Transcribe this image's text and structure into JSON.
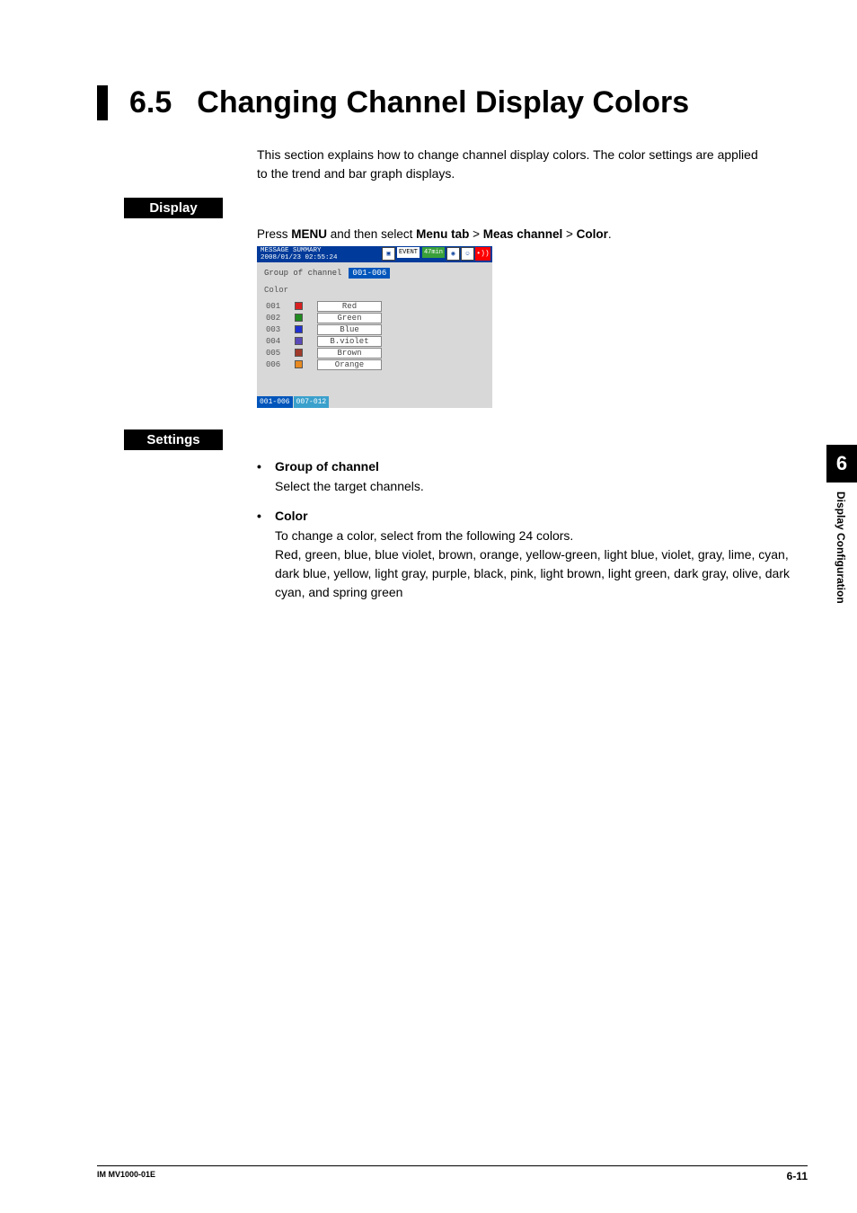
{
  "heading": {
    "num": "6.5",
    "title": "Changing Channel Display Colors"
  },
  "intro": "This section explains how to change channel display colors. The color settings are applied to the trend and bar graph displays.",
  "labels": {
    "display": "Display",
    "settings": "Settings"
  },
  "instruction": {
    "prefix": "Press ",
    "b1": "MENU",
    "mid1": " and then select ",
    "b2": "Menu tab",
    "sep": " > ",
    "b3": "Meas channel",
    "b4": "Color",
    "suffix": "."
  },
  "screenshot": {
    "header_line1": "MESSAGE SUMMARY",
    "header_line2": "2008/01/23 02:55:24",
    "pill_event": "EVENT",
    "pill_time": "47min",
    "group_label": "Group of channel",
    "group_value": "001-006",
    "color_label": "Color",
    "rows": [
      {
        "ch": "001",
        "color": "#d92020",
        "name": "Red"
      },
      {
        "ch": "002",
        "color": "#208a20",
        "name": "Green"
      },
      {
        "ch": "003",
        "color": "#2030d0",
        "name": "Blue"
      },
      {
        "ch": "004",
        "color": "#5a4ab8",
        "name": "B.violet"
      },
      {
        "ch": "005",
        "color": "#a03a2a",
        "name": "Brown"
      },
      {
        "ch": "006",
        "color": "#e88a20",
        "name": "Orange"
      }
    ],
    "tabs": [
      {
        "label": "001-006",
        "active": true
      },
      {
        "label": "007-012",
        "active": false
      }
    ],
    "alarm": "•))"
  },
  "settings": {
    "group": {
      "title": "Group of channel",
      "body": "Select the target channels."
    },
    "color": {
      "title": "Color",
      "line1": "To change a color, select from the following 24 colors.",
      "line2": "Red, green, blue, blue violet, brown, orange, yellow-green, light blue, violet, gray, lime, cyan, dark blue, yellow, light gray, purple, black, pink, light brown, light green, dark gray, olive, dark cyan, and spring green"
    }
  },
  "side": {
    "chapter": "6",
    "title": "Display Configuration"
  },
  "footer": {
    "left": "IM MV1000-01E",
    "right": "6-11"
  }
}
